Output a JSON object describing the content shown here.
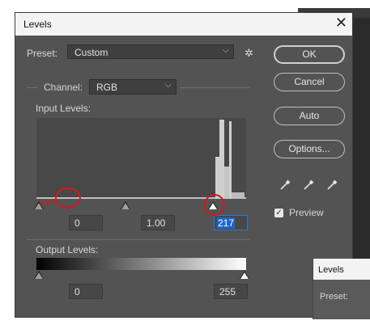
{
  "dialog": {
    "title": "Levels",
    "close_glyph": "✕",
    "preset_label": "Preset:",
    "preset_value": "Custom",
    "channel_label": "Channel:",
    "channel_value": "RGB",
    "input_levels_label": "Input Levels:",
    "input_black": "0",
    "input_gamma": "1.00",
    "input_white": "217",
    "output_levels_label": "Output Levels:",
    "output_black": "0",
    "output_white": "255",
    "buttons": {
      "ok": "OK",
      "cancel": "Cancel",
      "auto": "Auto",
      "options": "Options..."
    },
    "preview_label": "Preview",
    "preview_checked": true
  },
  "background_dialog": {
    "title": "Levels",
    "preset_label": "Preset:"
  },
  "icons": [
    "close-icon",
    "chevron-down-icon",
    "gear-icon",
    "black-eyedropper-icon",
    "gray-eyedropper-icon",
    "white-eyedropper-icon",
    "checkmark-icon"
  ],
  "colors": {
    "dialog_bg": "#535353",
    "annotation": "#d0191f",
    "selection": "#1e64c8"
  }
}
